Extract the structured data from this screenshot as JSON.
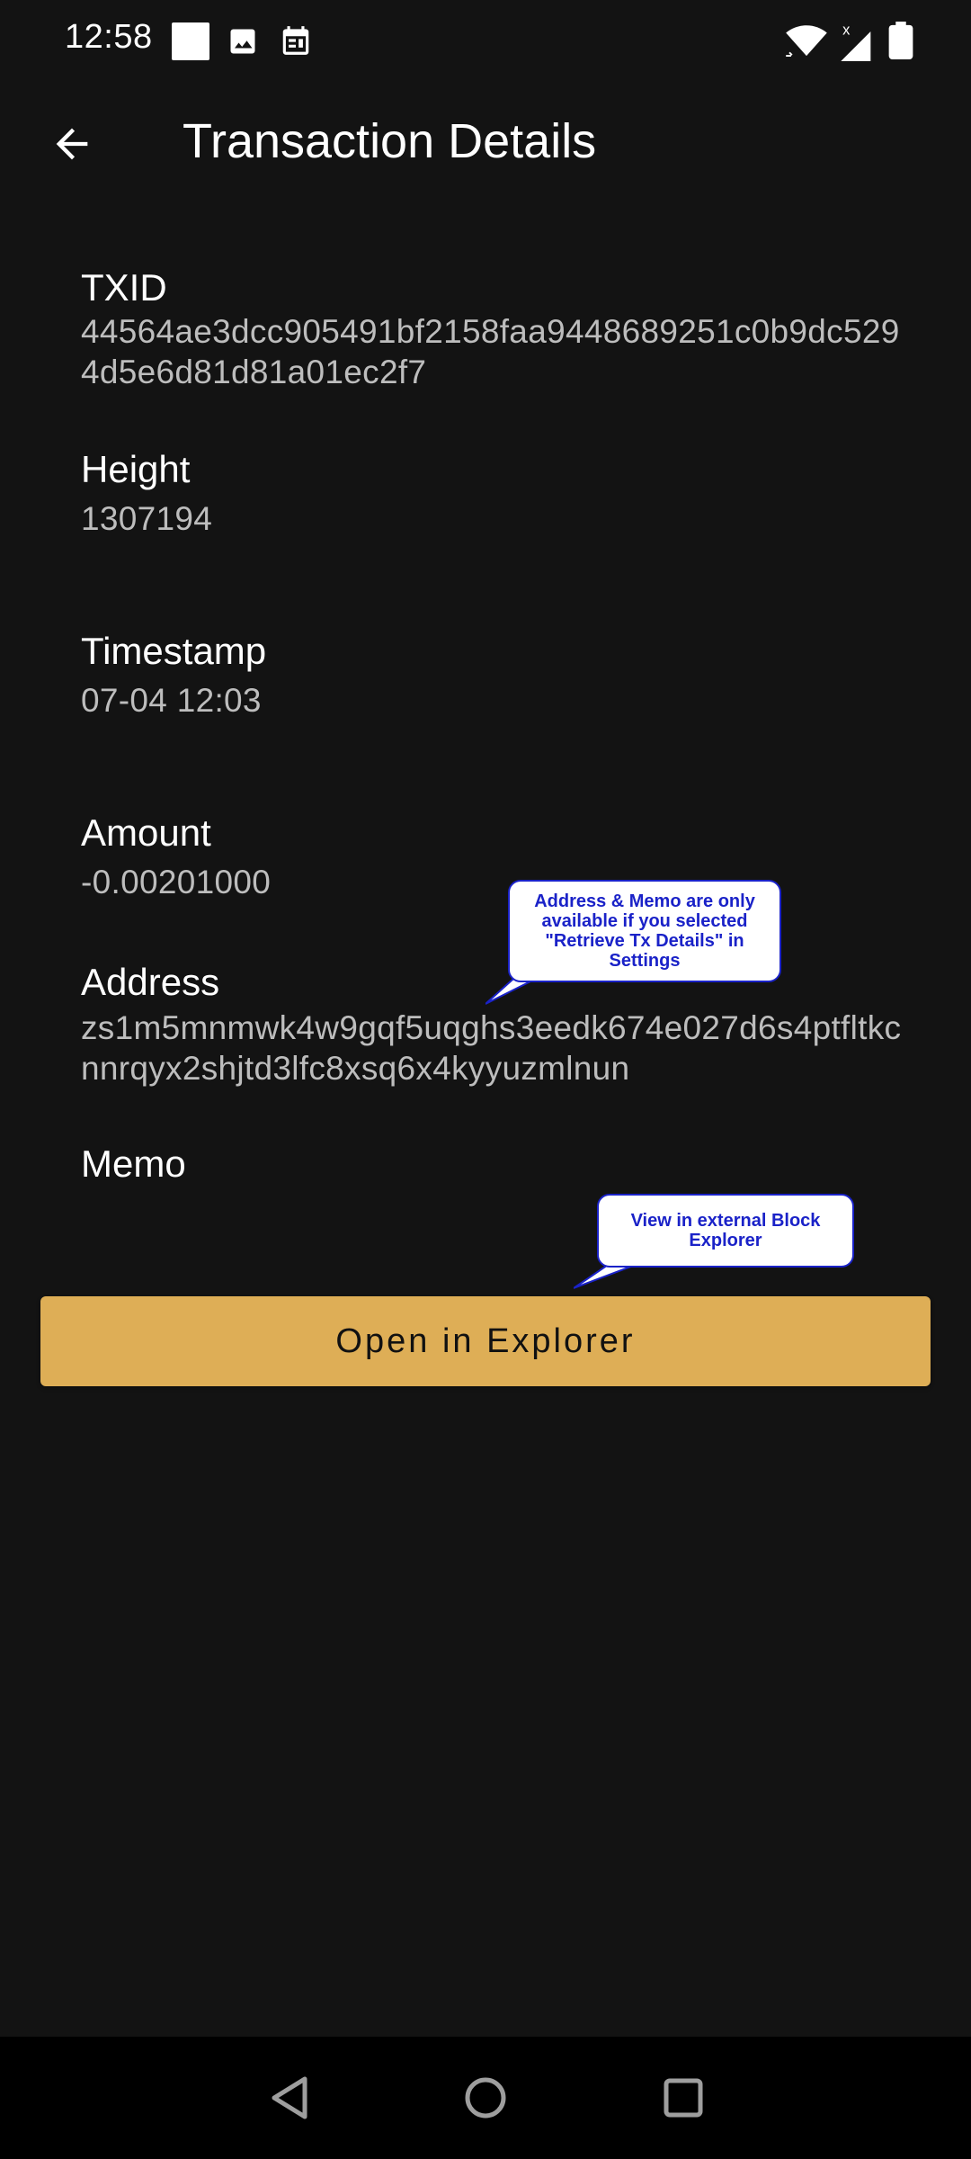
{
  "status_bar": {
    "time": "12:58"
  },
  "app_bar": {
    "title": "Transaction Details"
  },
  "fields": {
    "txid": {
      "label": "TXID",
      "value": "44564ae3dcc905491bf2158faa9448689251c0b9dc5294d5e6d81d81a01ec2f7"
    },
    "height": {
      "label": "Height",
      "value": "1307194"
    },
    "timestamp": {
      "label": "Timestamp",
      "value": "07-04 12:03"
    },
    "amount": {
      "label": "Amount",
      "value": "-0.00201000"
    },
    "address": {
      "label": "Address",
      "value": "zs1m5mnmwk4w9gqf5uqghs3eedk674e027d6s4ptfltkcnnrqyx2shjtd3lfc8xsq6x4kyyuzmlnun"
    },
    "memo": {
      "label": "Memo",
      "value": ""
    }
  },
  "callouts": {
    "address_memo": "Address & Memo are only available if you selected \"Retrieve Tx Details\" in Settings",
    "explorer": "View in external Block Explorer"
  },
  "explorer_button": {
    "label": "Open in Explorer"
  },
  "colors": {
    "background": "#131313",
    "accent": "#deae56",
    "callout_border": "#1a22c8"
  }
}
